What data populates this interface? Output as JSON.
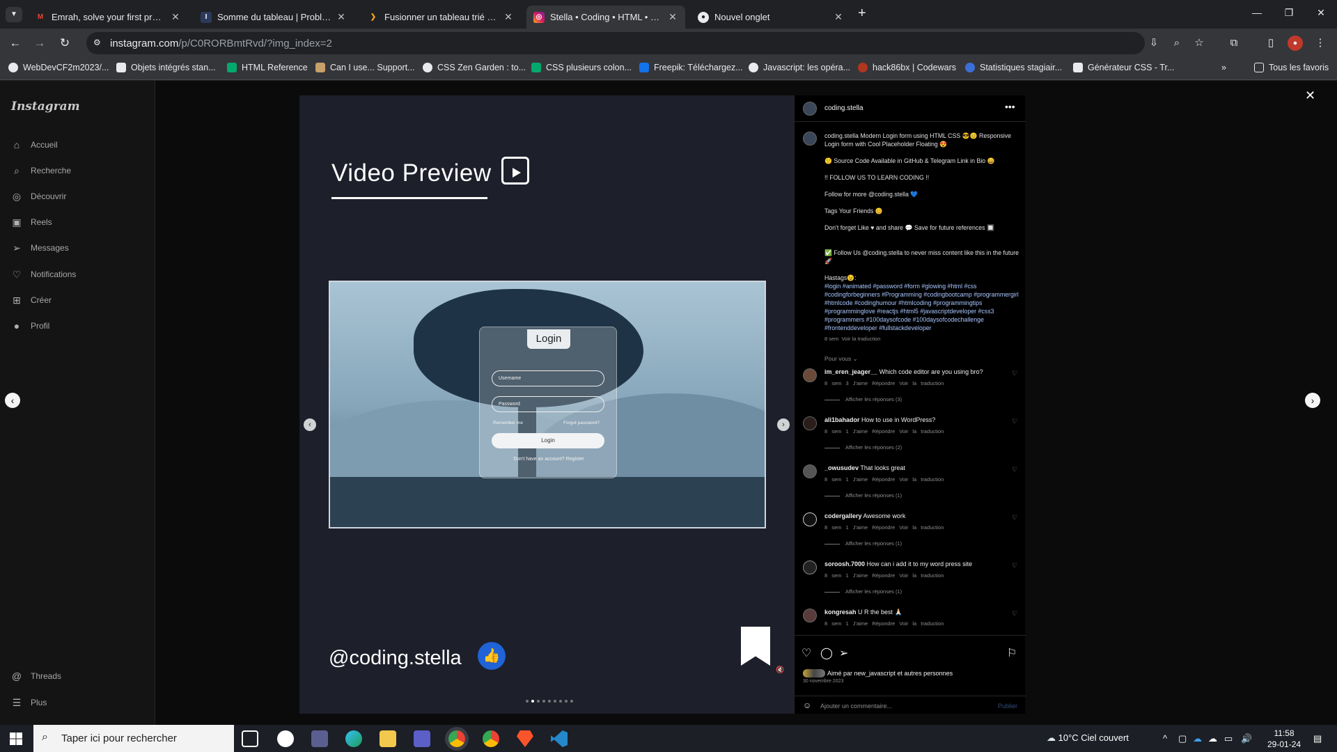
{
  "browser": {
    "tabs": [
      {
        "title": "Emrah, solve your first problem",
        "favicon": "gmail-icon",
        "active": false
      },
      {
        "title": "Somme du tableau | Problème",
        "favicon": "leetcode-icon",
        "active": false
      },
      {
        "title": "Fusionner un tableau trié - Leet",
        "favicon": "leetcode-icon",
        "active": false
      },
      {
        "title": "Stella • Coding • HTML • CSS • J",
        "favicon": "instagram-icon",
        "active": true
      },
      {
        "title": "Nouvel onglet",
        "favicon": "chrome-icon",
        "active": false
      }
    ],
    "url_host": "instagram.com",
    "url_path": "/p/C0RORBmtRvd/?img_index=2",
    "bookmarks": [
      "WebDevCF2m2023/...",
      "Objets intégrés stan...",
      "HTML Reference",
      "Can I use... Support...",
      "CSS Zen Garden : to...",
      "CSS plusieurs colon...",
      "Freepik: Téléchargez...",
      "Javascript: les opéra...",
      "hack86bx | Codewars",
      "Statistiques stagiair...",
      "Générateur CSS - Tr..."
    ],
    "bookmarks_folder": "Tous les favoris"
  },
  "sidebar": {
    "logo": "Instagram",
    "items": [
      {
        "label": "Accueil",
        "icon": "home-icon"
      },
      {
        "label": "Recherche",
        "icon": "search-icon"
      },
      {
        "label": "Découvrir",
        "icon": "compass-icon"
      },
      {
        "label": "Reels",
        "icon": "reels-icon"
      },
      {
        "label": "Messages",
        "icon": "send-icon"
      },
      {
        "label": "Notifications",
        "icon": "heart-icon"
      },
      {
        "label": "Créer",
        "icon": "plus-square-icon"
      },
      {
        "label": "Profil",
        "icon": "profile-icon"
      }
    ],
    "bottom_items": [
      {
        "label": "Threads",
        "icon": "threads-icon"
      },
      {
        "label": "Plus",
        "icon": "menu-icon"
      }
    ]
  },
  "media": {
    "title": "Video Preview",
    "handle": "@coding.stella",
    "login": {
      "title": "Login",
      "username_placeholder": "Username",
      "password_placeholder": "Password",
      "remember": "Remember me",
      "forgot": "Forgot password?",
      "button": "Login",
      "register": "Don't have an account? Register"
    }
  },
  "post": {
    "username": "coding.stella",
    "caption": [
      "coding.stella Modern Login form using HTML CSS 😎😊 Responsive Login form with Cool Placeholder Floating 😍",
      "🙂 Source Code Available in GitHub & Telegram Link in  Bio 😄",
      "!! FOLLOW US TO LEARN CODING !!",
      "Follow for more @coding.stella 💙",
      "Tags Your Friends 😊",
      "Don't forget Like ♥ and share 💬 Save for future references 🔲",
      "✅ Follow Us @coding.stella to never miss content like this in the future 🚀",
      "Hastags😉:"
    ],
    "hashtags": "#login #animated #password #form #glowing #html #css #codingforbeginners #Programming #codingbootcamp #programmergirl #htmlcode #codinghumour #htmlcoding #programmingtips #programminglove #reactjs #html5 #javascriptdeveloper #css3 #programmers #100daysofcode #100daysofcodechallenge #frontenddeveloper #fullstackdeveloper",
    "caption_time": "8 sem",
    "see_translation": "Voir la traduction",
    "filter": "Pour vous",
    "comments": [
      {
        "user": "im_eren_jeager__",
        "text": "Which code editor are you using bro?",
        "time": "8 sem",
        "likes": "3 J'aime",
        "reply": "Répondre",
        "translate": "Voir la traduction",
        "replies": "Afficher les réponses (3)"
      },
      {
        "user": "ali1bahador",
        "text": "How to use in WordPress?",
        "time": "8 sem",
        "likes": "1 J'aime",
        "reply": "Répondre",
        "translate": "Voir la traduction",
        "replies": "Afficher les réponses (2)"
      },
      {
        "user": "_owusudev",
        "text": "That looks great",
        "time": "8 sem",
        "likes": "1 J'aime",
        "reply": "Répondre",
        "translate": "Voir la traduction",
        "replies": "Afficher les réponses (1)"
      },
      {
        "user": "codergallery",
        "text": "Awesome work",
        "time": "8 sem",
        "likes": "1 J'aime",
        "reply": "Répondre",
        "translate": "Voir la traduction",
        "replies": "Afficher les réponses (1)"
      },
      {
        "user": "soroosh.7000",
        "text": "How can i add it to my word press site",
        "time": "8 sem",
        "likes": "1 J'aime",
        "reply": "Répondre",
        "translate": "Voir la traduction",
        "replies": "Afficher les réponses (1)"
      },
      {
        "user": "kongresah",
        "text": "U R the best 🙏🏻",
        "time": "8 sem",
        "likes": "1 J'aime",
        "reply": "Répondre",
        "translate": "Voir la traduction",
        "replies": ""
      }
    ],
    "liked_by": "Aimé par new_javascript et autres personnes",
    "date": "30 novembre 2023",
    "comment_placeholder": "Ajouter un commentaire...",
    "publish": "Publier"
  },
  "taskbar": {
    "search_placeholder": "Taper ici pour rechercher",
    "weather": "10°C  Ciel couvert",
    "time": "11:58",
    "date": "29-01-24"
  }
}
